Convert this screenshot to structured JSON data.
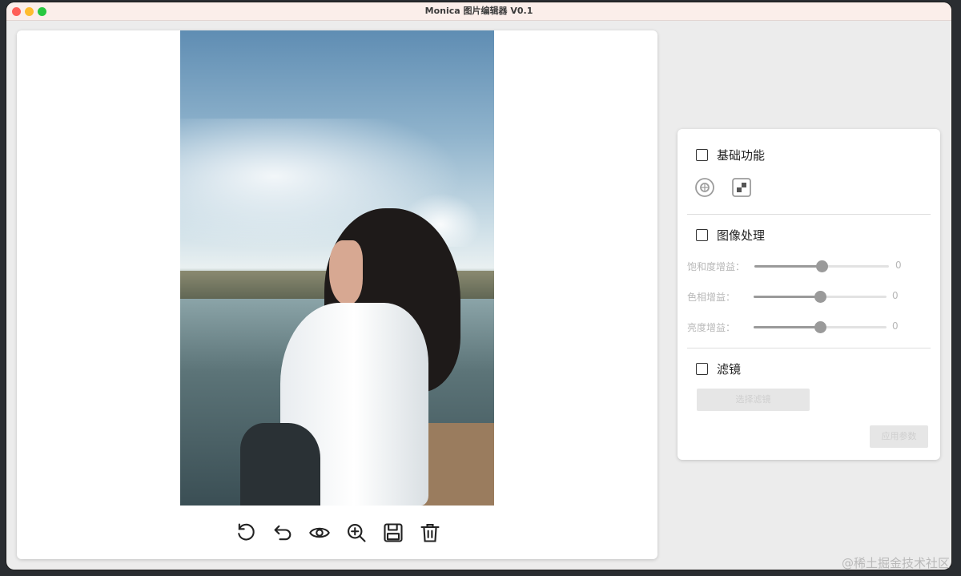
{
  "window": {
    "title": "Monica 图片编辑器 V0.1"
  },
  "toolbar": {
    "tools": [
      {
        "icon": "rotate-icon"
      },
      {
        "icon": "undo-icon"
      },
      {
        "icon": "eye-icon"
      },
      {
        "icon": "zoom-in-icon"
      },
      {
        "icon": "save-icon"
      },
      {
        "icon": "trash-icon"
      }
    ]
  },
  "panel": {
    "basic": {
      "title": "基础功能",
      "checked": false,
      "icons": [
        "target-icon",
        "crop-icon"
      ]
    },
    "image_processing": {
      "title": "图像处理",
      "checked": false,
      "sliders": [
        {
          "label": "饱和度增益：",
          "value": "0",
          "level": 0.5
        },
        {
          "label": "色相增益：",
          "value": "0",
          "level": 0.5
        },
        {
          "label": "亮度增益：",
          "value": "0",
          "level": 0.5
        }
      ]
    },
    "filter": {
      "title": "滤镜",
      "checked": false,
      "select_button": "选择滤镜",
      "apply_button": "应用参数"
    }
  },
  "watermark": "@稀土掘金技术社区",
  "colors": {
    "titlebar": "#fbeeea",
    "window_bg": "#ececec",
    "card_bg": "#ffffff",
    "slider_active": "#9a9a9a"
  }
}
